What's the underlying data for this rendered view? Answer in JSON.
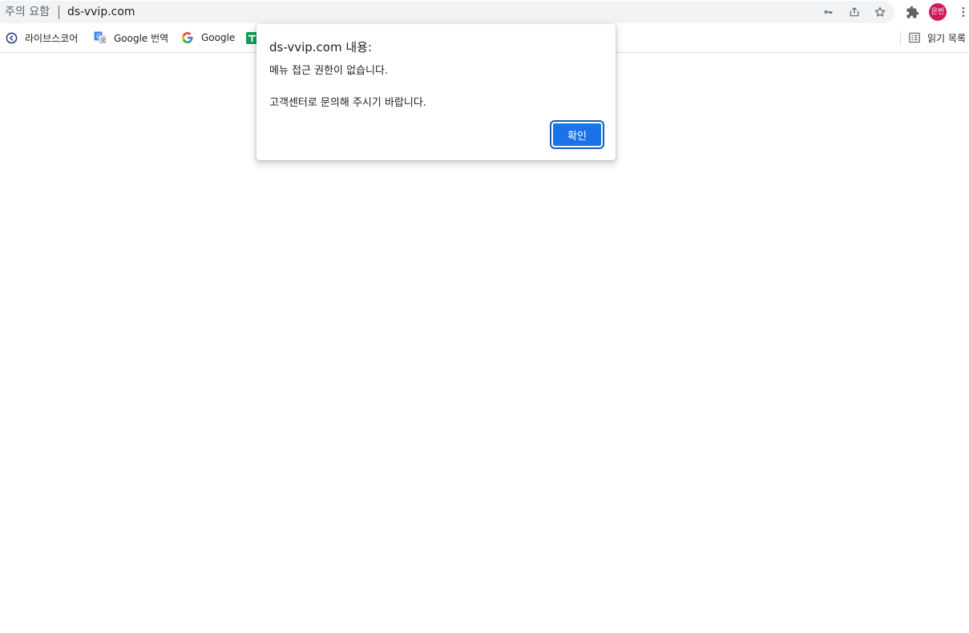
{
  "omnibox": {
    "security_label": "주의 요함",
    "url": "ds-vvip.com",
    "icons": [
      "key-icon",
      "share-icon",
      "star-icon"
    ]
  },
  "toolbar": {
    "extensions_icon": "puzzle-icon",
    "profile_avatar_text": "은빈",
    "profile_avatar_color": "#d01a5f",
    "menu_icon": "more-vert-icon"
  },
  "bookmarks": {
    "items": [
      {
        "label": "라이브스코어",
        "icon": "livescore-icon"
      },
      {
        "label": "Google 번역",
        "icon": "google-translate-icon"
      },
      {
        "label": "Google",
        "icon": "google-g-icon"
      },
      {
        "label": "",
        "icon": "green-bookmark-icon"
      }
    ],
    "reading_list_label": "읽기 목록"
  },
  "dialog": {
    "title": "ds-vvip.com 내용:",
    "message_line1": "메뉴 접근 권한이 없습니다.",
    "message_line2": "고객센터로 문의해 주시기 바랍니다.",
    "ok_label": "확인",
    "accent_color": "#1a73e8"
  }
}
